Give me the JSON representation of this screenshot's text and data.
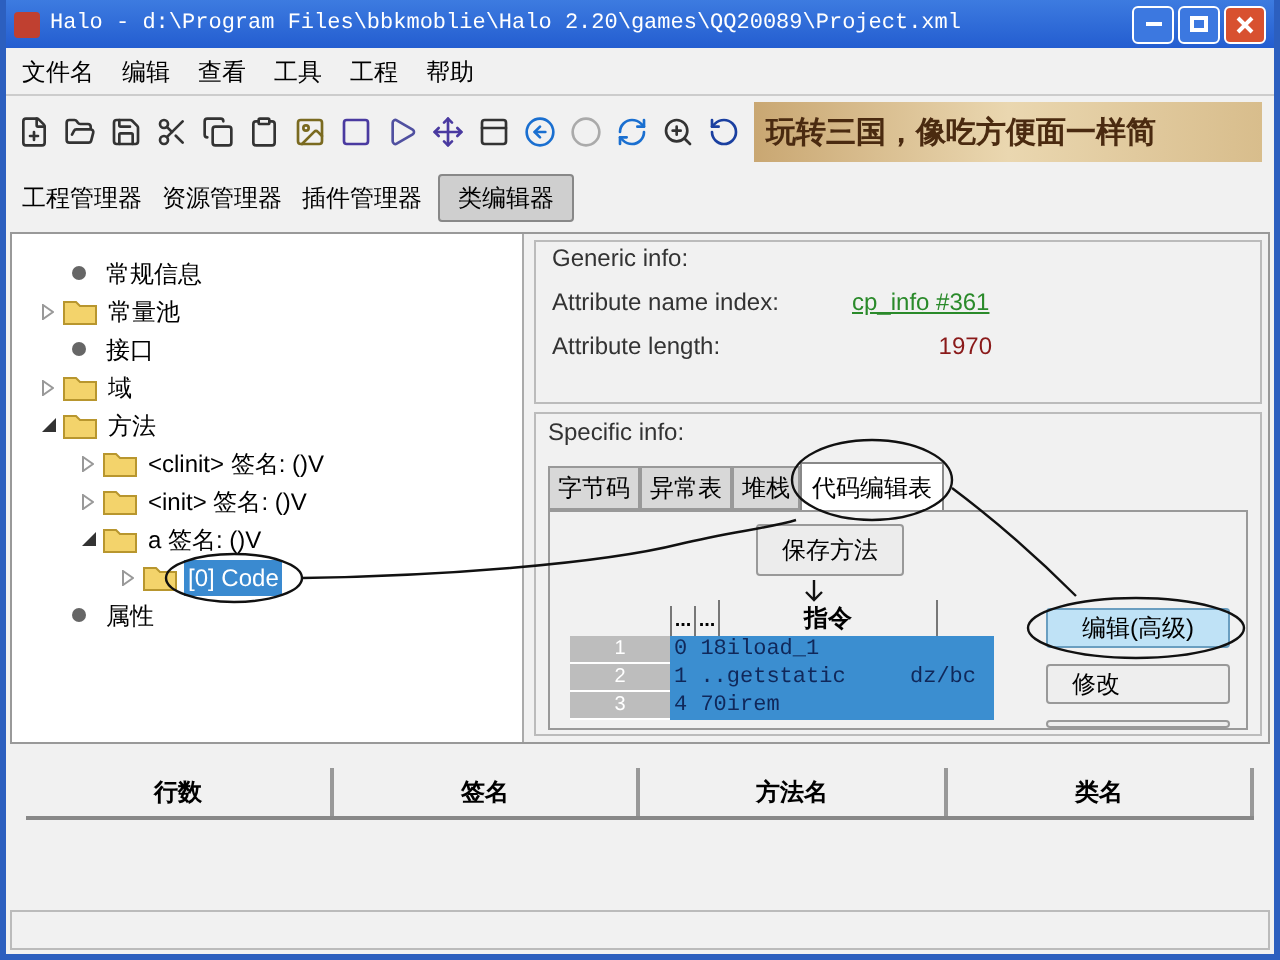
{
  "window": {
    "title": "Halo - d:\\Program Files\\bbkmoblie\\Halo 2.20\\games\\QQ20089\\Project.xml"
  },
  "menu": [
    "文件名",
    "编辑",
    "查看",
    "工具",
    "工程",
    "帮助"
  ],
  "banner": {
    "text": "玩转三国，像吃方便面一样简"
  },
  "tabs": [
    {
      "label": "工程管理器",
      "selected": false
    },
    {
      "label": "资源管理器",
      "selected": false
    },
    {
      "label": "插件管理器",
      "selected": false
    },
    {
      "label": "类编辑器",
      "selected": true
    }
  ],
  "tree": [
    {
      "label": "常规信息",
      "kind": "leaf",
      "selected": false
    },
    {
      "label": "常量池",
      "kind": "folder",
      "expanded": false,
      "selected": false
    },
    {
      "label": "接口",
      "kind": "leaf",
      "selected": false
    },
    {
      "label": "域",
      "kind": "folder",
      "expanded": false,
      "selected": false
    },
    {
      "label": "方法",
      "kind": "folder",
      "expanded": true,
      "selected": false,
      "children": [
        {
          "label": "<clinit> 签名: ()V",
          "kind": "folder",
          "expanded": false,
          "selected": false
        },
        {
          "label": "<init> 签名: ()V",
          "kind": "folder",
          "expanded": false,
          "selected": false
        },
        {
          "label": "a 签名: ()V",
          "kind": "folder",
          "expanded": true,
          "selected": false,
          "children": [
            {
              "label": "[0] Code",
              "kind": "folder",
              "expanded": false,
              "selected": true
            }
          ]
        }
      ]
    },
    {
      "label": "属性",
      "kind": "leaf",
      "selected": false
    }
  ],
  "generic_info": {
    "title": "Generic info:",
    "name_index_label": "Attribute name index:",
    "name_index_link": "cp_info #361",
    "length_label": "Attribute length:",
    "length_value": "1970"
  },
  "specific_info": {
    "title": "Specific info:",
    "tabs": [
      {
        "label": "字节码",
        "selected": false
      },
      {
        "label": "异常表",
        "selected": false
      },
      {
        "label": "堆栈",
        "selected": false
      },
      {
        "label": "代码编辑表",
        "selected": true
      }
    ],
    "save_button": "保存方法",
    "columns": [
      "...",
      "...",
      "指令"
    ],
    "rows": [
      {
        "number": "1",
        "col1": "0 18iload_1",
        "col3": ""
      },
      {
        "number": "2",
        "col1": "1 ..getstatic",
        "col3": "dz/bc"
      },
      {
        "number": "3",
        "col1": "4 70irem",
        "col3": ""
      }
    ],
    "buttons": [
      "编辑(高级)",
      "修改"
    ]
  },
  "bottom_table": {
    "columns": [
      "行数",
      "签名",
      "方法名",
      "类名"
    ]
  }
}
